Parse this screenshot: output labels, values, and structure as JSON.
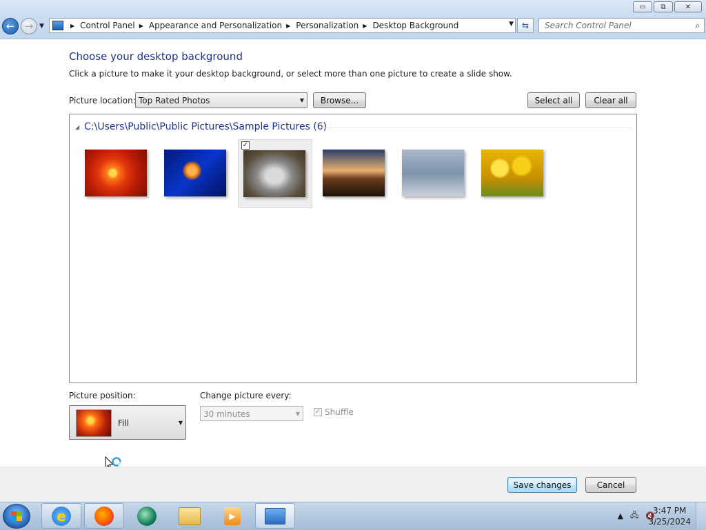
{
  "window": {
    "controls": {
      "minimize": "▭",
      "maximize": "⧉",
      "close": "✕"
    }
  },
  "nav": {
    "breadcrumbs": [
      "Control Panel",
      "Appearance and Personalization",
      "Personalization",
      "Desktop Background"
    ],
    "search_placeholder": "Search Control Panel"
  },
  "page": {
    "title": "Choose your desktop background",
    "subtitle": "Click a picture to make it your desktop background, or select more than one picture to create a slide show."
  },
  "location": {
    "label": "Picture location:",
    "value": "Top Rated Photos",
    "browse": "Browse...",
    "select_all": "Select all",
    "clear_all": "Clear all"
  },
  "pictures": {
    "group_header": "C:\\Users\\Public\\Public Pictures\\Sample Pictures (6)",
    "items": [
      {
        "name": "chrysanthemum",
        "selected": false,
        "checked": false
      },
      {
        "name": "jellyfish",
        "selected": false,
        "checked": false
      },
      {
        "name": "koala",
        "selected": true,
        "checked": true
      },
      {
        "name": "lighthouse",
        "selected": false,
        "checked": false
      },
      {
        "name": "penguins",
        "selected": false,
        "checked": false
      },
      {
        "name": "tulips",
        "selected": false,
        "checked": false
      }
    ]
  },
  "position": {
    "label": "Picture position:",
    "value": "Fill"
  },
  "interval": {
    "label": "Change picture every:",
    "value": "30 minutes",
    "enabled": false
  },
  "shuffle": {
    "label": "Shuffle",
    "checked": true,
    "enabled": false
  },
  "footer": {
    "save": "Save changes",
    "cancel": "Cancel"
  },
  "taskbar": {
    "apps": [
      "internet-explorer",
      "firefox",
      "windows-live",
      "windows-explorer",
      "media-player",
      "control-panel"
    ],
    "clock_time": "3:47 PM",
    "clock_date": "3/25/2024"
  },
  "colors": {
    "title_blue": "#1e3287",
    "accent": "#3c7fb1"
  }
}
